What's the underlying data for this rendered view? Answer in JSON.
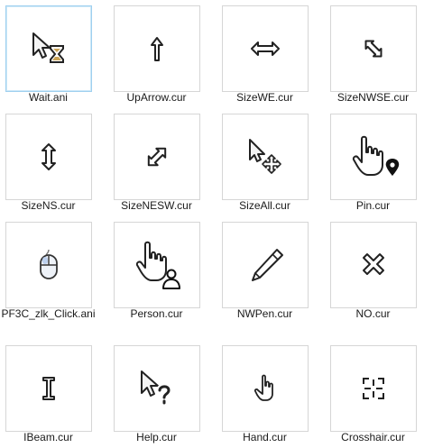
{
  "files": [
    {
      "name": "Wait.ani",
      "icon": "wait-hourglass-icon"
    },
    {
      "name": "UpArrow.cur",
      "icon": "up-arrow-icon"
    },
    {
      "name": "SizeWE.cur",
      "icon": "resize-horizontal-icon"
    },
    {
      "name": "SizeNWSE.cur",
      "icon": "resize-nwse-icon"
    },
    {
      "name": "SizeNS.cur",
      "icon": "resize-vertical-icon"
    },
    {
      "name": "SizeNESW.cur",
      "icon": "resize-nesw-icon"
    },
    {
      "name": "SizeAll.cur",
      "icon": "move-all-icon"
    },
    {
      "name": "Pin.cur",
      "icon": "hand-pin-icon"
    },
    {
      "name": "PF3C_zlk_Click.ani",
      "icon": "mouse-icon"
    },
    {
      "name": "Person.cur",
      "icon": "hand-person-icon"
    },
    {
      "name": "NWPen.cur",
      "icon": "pen-icon"
    },
    {
      "name": "NO.cur",
      "icon": "x-no-icon"
    },
    {
      "name": "IBeam.cur",
      "icon": "ibeam-icon"
    },
    {
      "name": "Help.cur",
      "icon": "help-arrow-icon"
    },
    {
      "name": "Hand.cur",
      "icon": "hand-icon"
    },
    {
      "name": "Crosshair.cur",
      "icon": "crosshair-icon"
    }
  ]
}
